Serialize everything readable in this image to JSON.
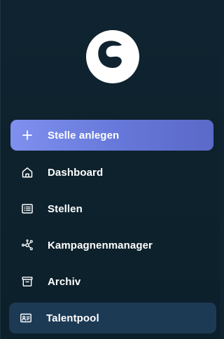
{
  "brand": {
    "logo_icon": "c-brand-logo-icon"
  },
  "sidebar": {
    "primary_action": {
      "label": "Stelle anlegen",
      "icon": "plus-icon"
    },
    "items": [
      {
        "label": "Dashboard",
        "icon": "home-icon"
      },
      {
        "label": "Stellen",
        "icon": "list-icon"
      },
      {
        "label": "Kampagnenmanager",
        "icon": "network-icon"
      },
      {
        "label": "Archiv",
        "icon": "archive-icon"
      },
      {
        "label": "Talentpool",
        "icon": "contact-card-icon",
        "active": true
      }
    ]
  },
  "colors": {
    "background": "#0f2430",
    "primary_gradient_start": "#7f90ef",
    "primary_gradient_end": "#5b69c8",
    "active_item": "#1d3a55",
    "text": "#ffffff"
  }
}
